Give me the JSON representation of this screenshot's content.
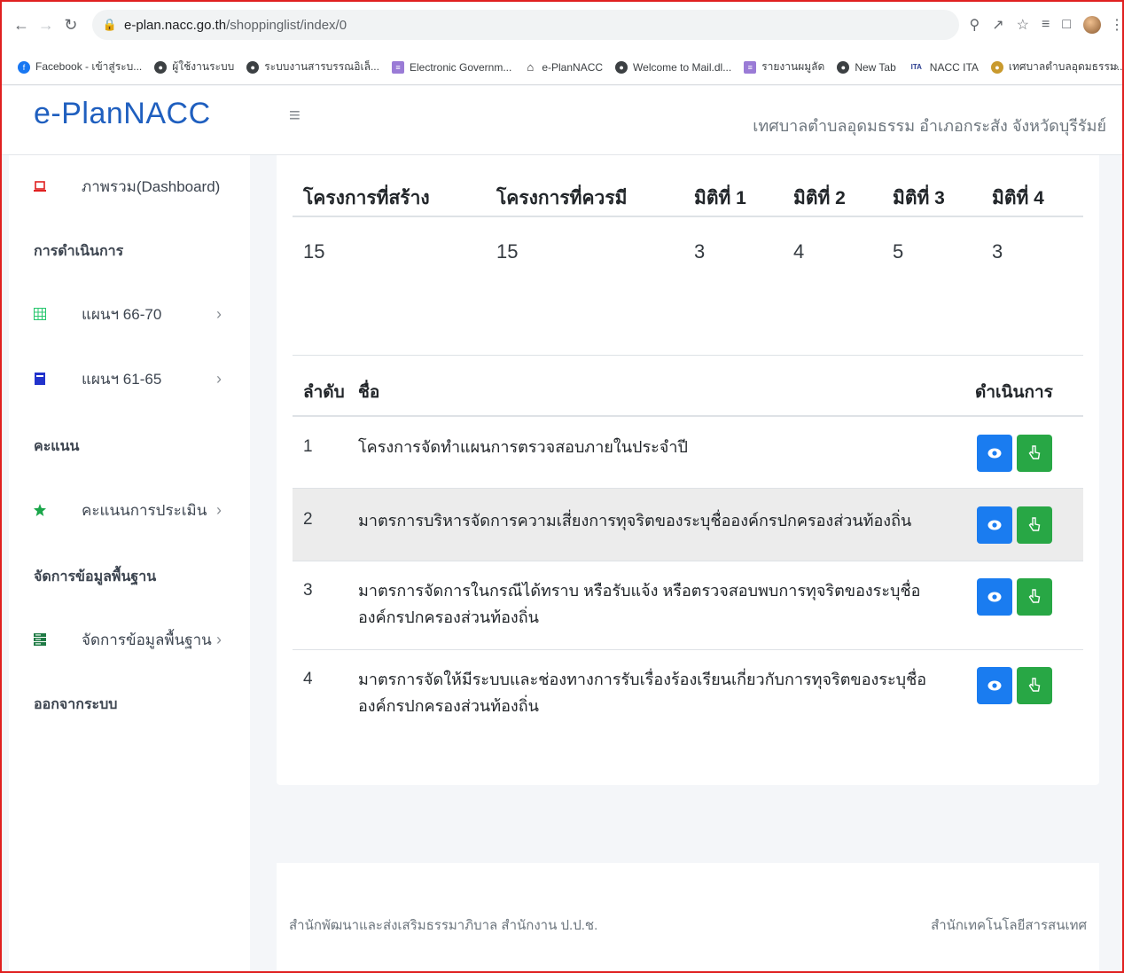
{
  "browser": {
    "url_host": "e-plan.nacc.go.th",
    "url_path": "/shoppinglist/index/0",
    "bookmarks": [
      {
        "label": "Facebook - เข้าสู่ระบ...",
        "icon": "facebook-icon",
        "color": "#1877f2"
      },
      {
        "label": "ผู้ใช้งานระบบ",
        "icon": "globe-icon",
        "color": "#3c4043"
      },
      {
        "label": "ระบบงานสารบรรณอิเล็...",
        "icon": "globe-icon",
        "color": "#3c4043"
      },
      {
        "label": "Electronic Governm...",
        "icon": "ega-icon",
        "color": "#9a7bd6"
      },
      {
        "label": "e-PlanNACC",
        "icon": "home-icon",
        "color": "#202124"
      },
      {
        "label": "Welcome to Mail.dl...",
        "icon": "globe-icon",
        "color": "#3c4043"
      },
      {
        "label": "รายงานผมูลัด",
        "icon": "ega-icon",
        "color": "#9a7bd6"
      },
      {
        "label": "New Tab",
        "icon": "globe-icon",
        "color": "#3c4043"
      },
      {
        "label": "NACC ITA",
        "icon": "ita-icon",
        "color": "#2a3d8f"
      },
      {
        "label": "เทศบาลตำบลอุดมธรรม...",
        "icon": "seal-icon",
        "color": "#c99a2e"
      }
    ],
    "more": "»"
  },
  "header": {
    "logo": "e-PlanNACC",
    "organization": "เทศบาลตำบลอุดมธรรม อำเภอกระสัง จังหวัดบุรีรัมย์"
  },
  "sidebar": {
    "dashboard": "ภาพรวม(Dashboard)",
    "section_ops": "การดำเนินการ",
    "plan_66_70": "แผนฯ 66-70",
    "plan_61_65": "แผนฯ 61-65",
    "section_score": "คะแนน",
    "score_eval": "คะแนนการประเมิน",
    "section_basic": "จัดการข้อมูลพื้นฐาน",
    "basic_manage": "จัดการข้อมูลพื้นฐาน",
    "logout": "ออกจากระบบ"
  },
  "stats": {
    "headers": [
      "โครงการที่สร้าง",
      "โครงการที่ควรมี",
      "มิติที่ 1",
      "มิติที่ 2",
      "มิติที่ 3",
      "มิติที่ 4"
    ],
    "values": [
      "15",
      "15",
      "3",
      "4",
      "5",
      "3"
    ]
  },
  "table": {
    "col_no": "ลำดับ",
    "col_name": "ชื่อ",
    "col_action": "ดำเนินการ",
    "rows": [
      {
        "no": "1",
        "name": "โครงการจัดทำแผนการตรวจสอบภายในประจำปี"
      },
      {
        "no": "2",
        "name": "มาตรการบริหารจัดการความเสี่ยงการทุจริตของระบุชื่อองค์กรปกครองส่วนท้องถิ่น"
      },
      {
        "no": "3",
        "name": "มาตรการจัดการในกรณีได้ทราบ หรือรับแจ้ง หรือตรวจสอบพบการทุจริตของระบุชื่อองค์กรปกครองส่วนท้องถิ่น"
      },
      {
        "no": "4",
        "name": "มาตรการจัดให้มีระบบและช่องทางการรับเรื่องร้องเรียนเกี่ยวกับการทุจริตของระบุชื่อองค์กรปกครองส่วนท้องถิ่น"
      }
    ]
  },
  "footer": {
    "left": "สำนักพัฒนาและส่งเสริมธรรมาภิบาล สำนักงาน ป.ป.ช.",
    "right": "สำนักเทคโนโลยีสารสนเทศ"
  },
  "colors": {
    "brand": "#1f5fbf",
    "view_button": "#1a7cf0",
    "act_button": "#28a745",
    "frame": "#e02020"
  }
}
